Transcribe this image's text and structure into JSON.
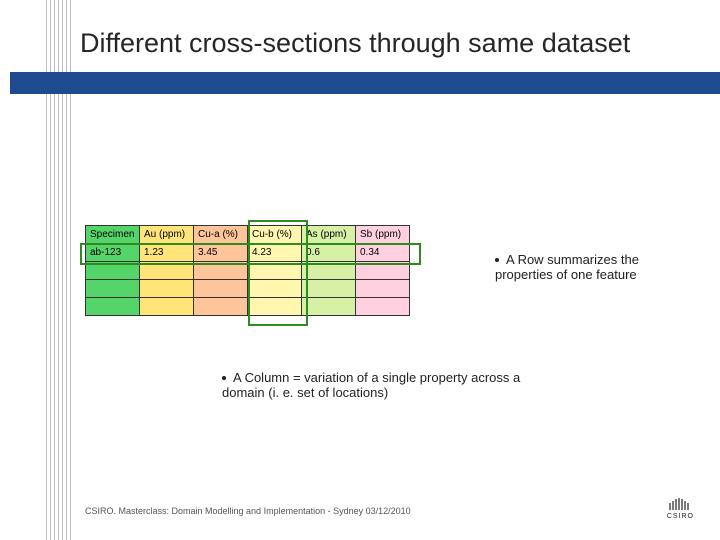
{
  "title": "Different cross-sections through same dataset",
  "table": {
    "header_corner": "Specimen",
    "cols": [
      "Au (ppm)",
      "Cu-a (%)",
      "Cu-b (%)",
      "As (ppm)",
      "Sb (ppm)"
    ],
    "first_spec": "ab-123",
    "row1": [
      "1.23",
      "3.45",
      "4.23",
      "0.6",
      "0.34"
    ]
  },
  "row_note": "A Row summarizes the properties of one feature",
  "col_note": "A Column = variation of a single property across a domain (i. e. set of locations)",
  "footer": "CSIRO.  Masterclass: Domain Modelling and Implementation - Sydney 03/12/2010",
  "logo_text": "CSIRO"
}
